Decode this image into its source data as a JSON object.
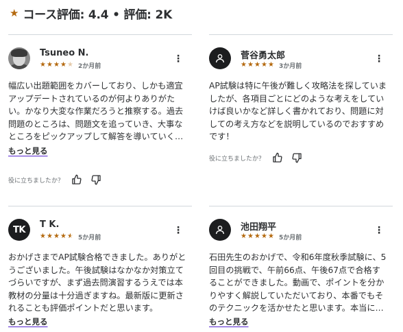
{
  "header": {
    "title": "コース評価: 4.4 • 評価: 2K",
    "star_color": "#b4690e"
  },
  "helpful_question": "役に立ちましたか？",
  "more_label": "もっと見る",
  "reviews": [
    {
      "name": "Tsuneo N.",
      "avatar": "photo",
      "rating": 4,
      "date": "2か月前",
      "text": "幅広い出題範囲をカバーしており、しかも適宜アップデートされているのが何よりありがたい。かなり大変な作業だろうと推察する。過去問題のところは、問題文を追っていき、大事なところをピックアップして解答を導いていく流れが分かりやすい。"
    },
    {
      "name": "菅谷勇太郎",
      "avatar": "person-icon",
      "rating": 5,
      "date": "3か月前",
      "text": "AP試験は特に午後が難しく攻略法を探していましたが、各項目ごとにどのような考えをしていけば良いかなど詳しく書かれており、問題に対しての考え方などを説明しているのでおすすめです！"
    },
    {
      "name": "T K.",
      "avatar": "initials",
      "initials": "TK",
      "rating": 4.5,
      "date": "5か月前",
      "text": "おかげさまでAP試験合格できました。ありがとうございました。午後試験はなかなか対策立てづらいですが、まず過去問演習するうえでは本教材の分量は十分過ぎますね。最新版に更新されることも評価ポイントだと思います。"
    },
    {
      "name": "池田翔平",
      "avatar": "person-icon",
      "rating": 5,
      "date": "5か月前",
      "text": "石田先生のおかげで、令和6年度秋季試験に、5回目の挑戦で、午前66点、午後67点で合格することができました。動画で、ポイントを分かりやすく解説していただいており、本番でもそのテクニックを活かせたと思います。本当にありがとうございました。"
    }
  ]
}
